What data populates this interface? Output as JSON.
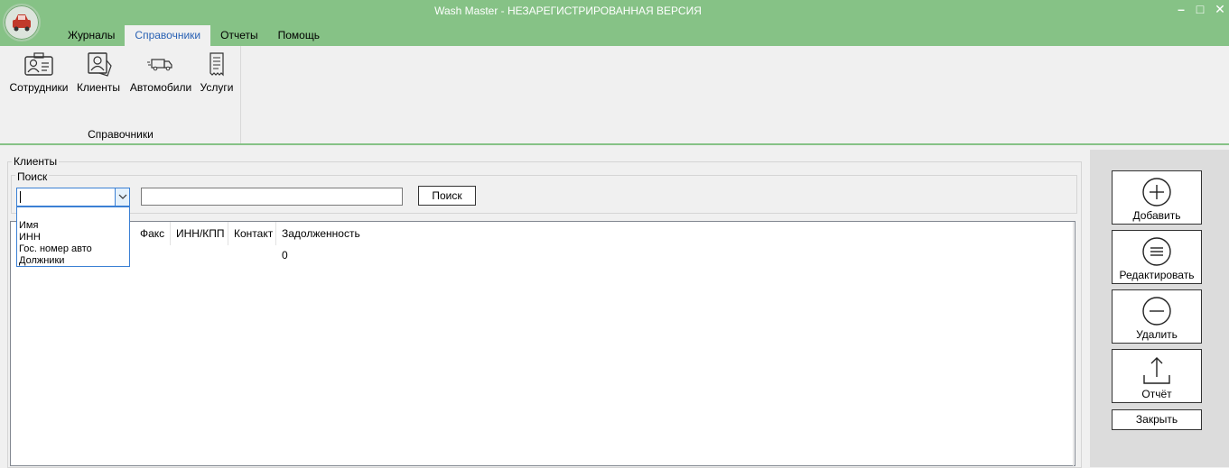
{
  "window": {
    "title": "Wash Master - НЕЗАРЕГИСТРИРОВАННАЯ ВЕРСИЯ",
    "logo_icon": "car-icon",
    "controls": {
      "minimize": "–",
      "maximize": "□",
      "close": "✕"
    }
  },
  "menu": {
    "tabs": [
      {
        "label": "Журналы",
        "active": false
      },
      {
        "label": "Справочники",
        "active": true
      },
      {
        "label": "Отчеты",
        "active": false
      },
      {
        "label": "Помощь",
        "active": false
      }
    ]
  },
  "ribbon": {
    "group_label": "Справочники",
    "buttons": [
      {
        "label": "Сотрудники",
        "icon": "employee-card-icon"
      },
      {
        "label": "Клиенты",
        "icon": "client-card-icon"
      },
      {
        "label": "Автомобили",
        "icon": "truck-icon"
      },
      {
        "label": "Услуги",
        "icon": "receipt-icon"
      }
    ]
  },
  "clients": {
    "group_label": "Клиенты",
    "search": {
      "group_label": "Поиск",
      "combo_value": "",
      "text_value": "",
      "button_label": "Поиск",
      "options": [
        "Имя",
        "ИНН",
        "Гос. номер авто",
        "Должники"
      ]
    },
    "columns": [
      "Факс",
      "ИНН/КПП",
      "Контакт",
      "Задолженность"
    ],
    "rows": [
      {
        "Задолженность": "0"
      }
    ]
  },
  "actions": {
    "add": "Добавить",
    "edit": "Редактировать",
    "delete": "Удалить",
    "report": "Отчёт",
    "close": "Закрыть"
  },
  "colors": {
    "accent": "#86c286",
    "active_tab_text": "#2a62b4",
    "focus_border": "#3b80d4"
  }
}
